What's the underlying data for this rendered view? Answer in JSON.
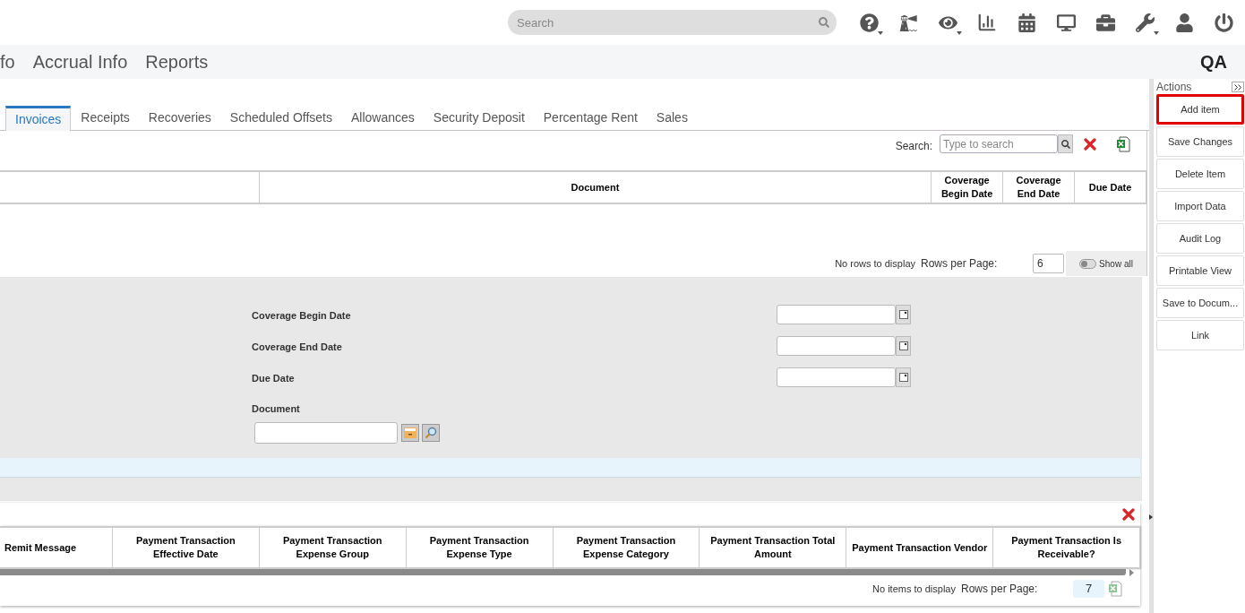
{
  "topbar": {
    "search": {
      "placeholder": "Search"
    }
  },
  "nav": {
    "items": [
      "fo",
      "Accrual Info",
      "Reports"
    ],
    "badge": "QA"
  },
  "tabs": [
    {
      "label": "Invoices",
      "selected": true
    },
    {
      "label": "Receipts",
      "selected": false
    },
    {
      "label": "Recoveries",
      "selected": false
    },
    {
      "label": "Scheduled Offsets",
      "selected": false
    },
    {
      "label": "Allowances",
      "selected": false
    },
    {
      "label": "Security Deposit",
      "selected": false
    },
    {
      "label": "Percentage Rent",
      "selected": false
    },
    {
      "label": "Sales",
      "selected": false
    }
  ],
  "grid": {
    "search_label": "Search:",
    "search_placeholder": "Type to search",
    "columns": [
      "Document",
      "Coverage Begin Date",
      "Coverage End Date",
      "Due Date"
    ],
    "pager": {
      "message": "No rows to display",
      "rows_label": "Rows per Page:",
      "rows_value": "6",
      "show_all": {
        "label": "Show all",
        "on": false
      }
    }
  },
  "form": {
    "fields": [
      {
        "label": "Coverage Begin Date",
        "kind": "date"
      },
      {
        "label": "Coverage End Date",
        "kind": "date"
      },
      {
        "label": "Due Date",
        "kind": "date"
      },
      {
        "label": "Document",
        "kind": "document"
      }
    ]
  },
  "transactions": {
    "columns": [
      "Remit Message",
      "Payment Transaction Effective Date",
      "Payment Transaction Expense Group",
      "Payment Transaction Expense Type",
      "Payment Transaction Expense Category",
      "Payment Transaction Total Amount",
      "Payment Transaction Vendor",
      "Payment Transaction Is Receivable?"
    ],
    "pager": {
      "message": "No items to display",
      "rows_label": "Rows per Page:",
      "rows_value": "7"
    }
  },
  "actions": {
    "title": "Actions",
    "buttons": [
      {
        "label": "Add item",
        "highlighted": true
      },
      {
        "label": "Save Changes",
        "highlighted": false
      },
      {
        "label": "Delete Item",
        "highlighted": false
      },
      {
        "label": "Import Data",
        "highlighted": false
      },
      {
        "label": "Audit Log",
        "highlighted": false
      },
      {
        "label": "Printable View",
        "highlighted": false
      },
      {
        "label": "Save to Docum...",
        "highlighted": false
      },
      {
        "label": "Link",
        "highlighted": false
      }
    ]
  }
}
